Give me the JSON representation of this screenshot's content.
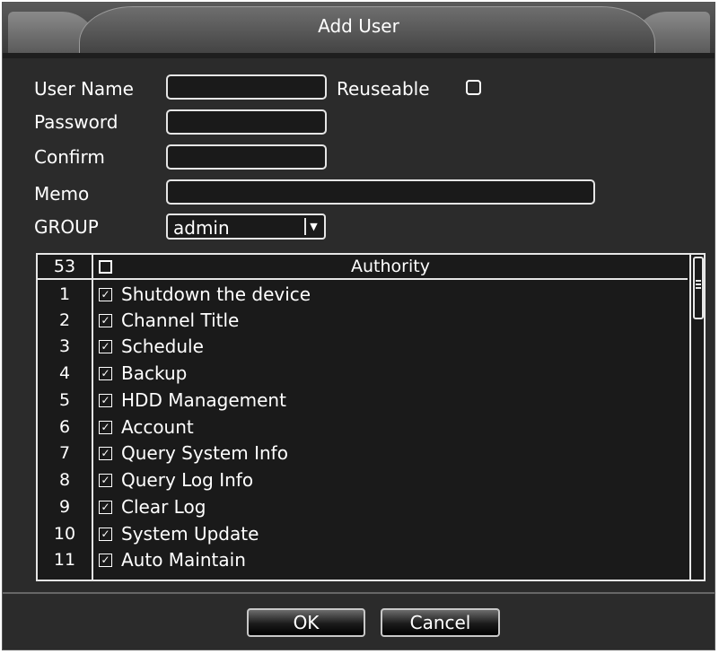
{
  "window": {
    "title": "Add User"
  },
  "form": {
    "user_name_label": "User Name",
    "user_name_value": "",
    "reuseable_label": "Reuseable",
    "reuseable_checked": false,
    "password_label": "Password",
    "password_value": "",
    "confirm_label": "Confirm",
    "confirm_value": "",
    "memo_label": "Memo",
    "memo_value": "",
    "group_label": "GROUP",
    "group_value": "admin"
  },
  "authority_table": {
    "count": "53",
    "header": "Authority",
    "rows": [
      {
        "num": "1",
        "label": "Shutdown the device",
        "checked": true
      },
      {
        "num": "2",
        "label": "Channel Title",
        "checked": true
      },
      {
        "num": "3",
        "label": "Schedule",
        "checked": true
      },
      {
        "num": "4",
        "label": "Backup",
        "checked": true
      },
      {
        "num": "5",
        "label": "HDD Management",
        "checked": true
      },
      {
        "num": "6",
        "label": "Account",
        "checked": true
      },
      {
        "num": "7",
        "label": "Query System Info",
        "checked": true
      },
      {
        "num": "8",
        "label": "Query Log Info",
        "checked": true
      },
      {
        "num": "9",
        "label": "Clear Log",
        "checked": true
      },
      {
        "num": "10",
        "label": "System Update",
        "checked": true
      },
      {
        "num": "11",
        "label": "Auto Maintain",
        "checked": true
      }
    ]
  },
  "buttons": {
    "ok": "OK",
    "cancel": "Cancel"
  },
  "icons": {
    "checked": "checkbox-checked-icon",
    "dropdown": "chevron-down-icon"
  }
}
